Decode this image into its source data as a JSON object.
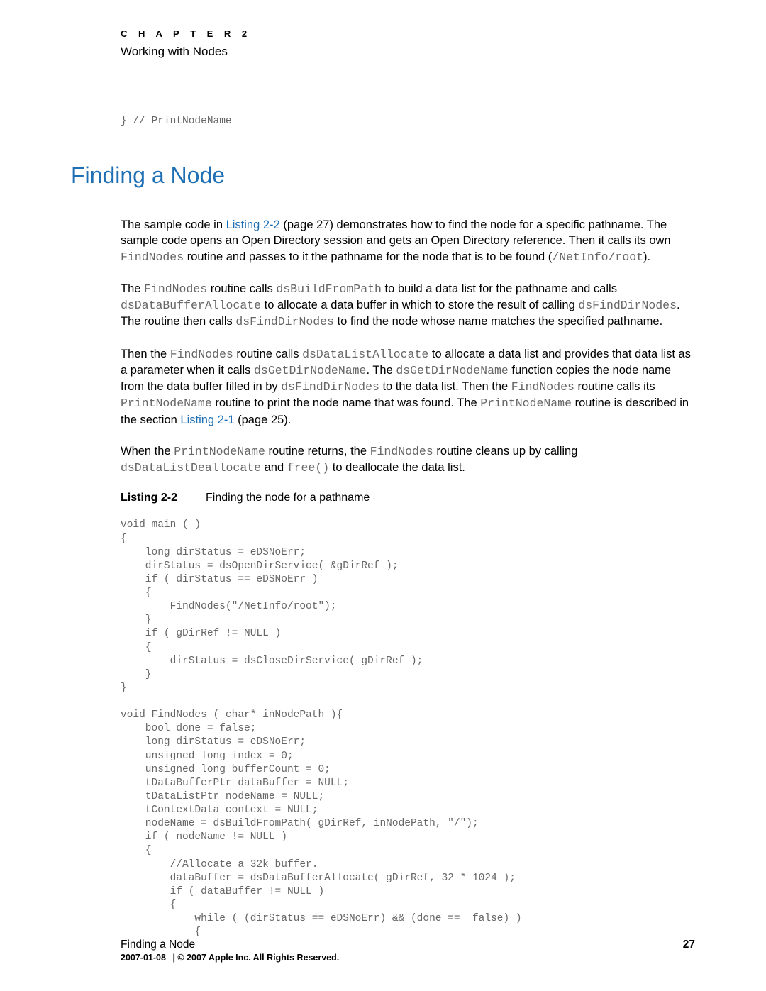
{
  "chapter": {
    "label": "C H A P T E R   2",
    "title": "Working with Nodes"
  },
  "top_code": "} // PrintNodeName",
  "heading": "Finding a Node",
  "para1": {
    "t1": "The sample code in ",
    "link": "Listing 2-2",
    "t2": " (page 27) demonstrates how to find the node for a specific pathname. The sample code opens an Open Directory session and gets an Open Directory reference. Then it calls its own ",
    "c1": "FindNodes",
    "t3": " routine and passes to it the pathname for the node that is to be found (",
    "c2": "/NetInfo/root",
    "t4": ")."
  },
  "para2": {
    "t1": "The ",
    "c1": "FindNodes",
    "t2": " routine calls ",
    "c2": "dsBuildFromPath",
    "t3": " to build a data list for the pathname and calls ",
    "c3": "dsDataBufferAllocate",
    "t4": " to allocate a data buffer in which to store the result of calling ",
    "c4": "dsFindDirNodes",
    "t5": ". The routine then calls ",
    "c5": "dsFindDirNodes",
    "t6": " to find the node whose name matches the specified pathname."
  },
  "para3": {
    "t1": "Then the ",
    "c1": "FindNodes",
    "t2": " routine calls ",
    "c2": "dsDataListAllocate",
    "t3": " to allocate a data list and provides that data list as a parameter when it calls ",
    "c3": "dsGetDirNodeName",
    "t4": ". The ",
    "c4": "dsGetDirNodeName",
    "t5": " function copies the node name from the data buffer filled in by ",
    "c5": "dsFindDirNodes",
    "t6": " to the data list. Then the ",
    "c6": "FindNodes",
    "t7": " routine calls its ",
    "c7": "PrintNodeName",
    "t8": " routine to print the node name that was found. The ",
    "c8": "PrintNodeName",
    "t9": " routine is described in the section ",
    "link": "Listing 2-1",
    "t10": " (page 25)."
  },
  "para4": {
    "t1": "When the ",
    "c1": "PrintNodeName",
    "t2": " routine returns, the ",
    "c2": "FindNodes",
    "t3": " routine cleans up by calling ",
    "c3": "dsDataListDeallocate",
    "t4": " and ",
    "c4": "free()",
    "t5": " to deallocate the data list."
  },
  "listing": {
    "label": "Listing 2-2",
    "caption": "Finding the node for a pathname"
  },
  "code": "void main ( )\n{\n    long dirStatus = eDSNoErr;\n    dirStatus = dsOpenDirService( &gDirRef );\n    if ( dirStatus == eDSNoErr )\n    {\n        FindNodes(\"/NetInfo/root\");\n    }\n    if ( gDirRef != NULL )\n    {\n        dirStatus = dsCloseDirService( gDirRef );\n    }\n}\n\nvoid FindNodes ( char* inNodePath ){\n    bool done = false;\n    long dirStatus = eDSNoErr;\n    unsigned long index = 0;\n    unsigned long bufferCount = 0;\n    tDataBufferPtr dataBuffer = NULL;\n    tDataListPtr nodeName = NULL;\n    tContextData context = NULL;\n    nodeName = dsBuildFromPath( gDirRef, inNodePath, \"/\");\n    if ( nodeName != NULL )\n    {\n        //Allocate a 32k buffer.\n        dataBuffer = dsDataBufferAllocate( gDirRef, 32 * 1024 );\n        if ( dataBuffer != NULL )\n        {\n            while ( (dirStatus == eDSNoErr) && (done ==  false) )\n            {",
  "footer": {
    "section": "Finding a Node",
    "page": "27",
    "date": "2007-01-08",
    "sep": "|",
    "copyright": "© 2007 Apple Inc. All Rights Reserved."
  }
}
